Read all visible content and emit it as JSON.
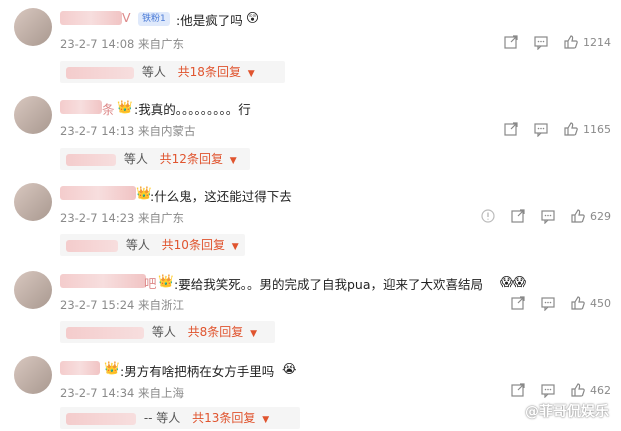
{
  "comments": [
    {
      "text": ":他是疯了吗",
      "emoji": "😲",
      "name_suffix": "V",
      "fan_badge": "铁粉1",
      "meta": "23-2-7 14:08 来自广东",
      "likes": "1214",
      "reply_deng": "等人",
      "reply_more": "共18条回复"
    },
    {
      "text": ":我真的。。。。。。。。。行",
      "name_suffix": "条",
      "meta": "23-2-7 14:13 来自内蒙古",
      "likes": "1165",
      "reply_deng": "等人",
      "reply_more": "共12条回复"
    },
    {
      "text": ":什么鬼，这还能过得下去",
      "meta": "23-2-7 14:23 来自广东",
      "likes": "629",
      "reply_deng": "等人",
      "reply_more": "共10条回复"
    },
    {
      "text": ":要给我笑死。。男的完成了自我pua，迎来了大欢喜结局",
      "emoji": "😱😱",
      "name_suffix": "吧",
      "meta": "23-2-7 15:24 来自浙江",
      "likes": "450",
      "reply_deng": "等人",
      "reply_more": "共8条回复"
    },
    {
      "text": ":男方有啥把柄在女方手里吗",
      "emoji": "😭",
      "meta": "23-2-7 14:34 来自上海",
      "likes": "462",
      "reply_deng": "-- 等人",
      "reply_more": "共13条回复"
    }
  ],
  "watermark": "@菲哥侃娱乐",
  "colors": {
    "accent": "#e0542e",
    "meta": "#8a8a8a"
  }
}
